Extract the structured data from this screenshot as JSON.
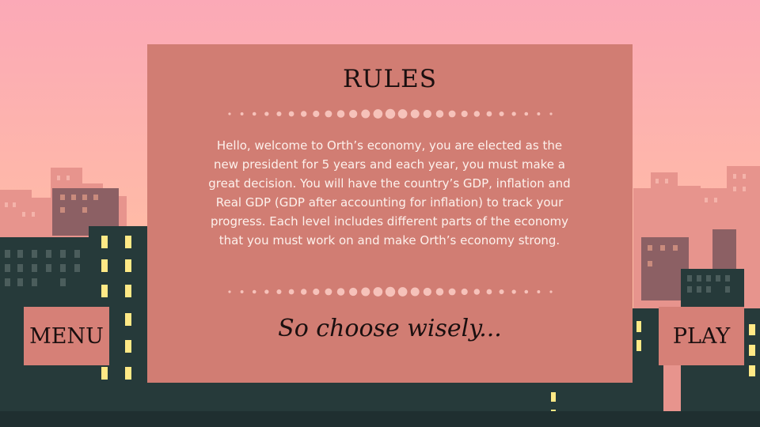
{
  "rules": {
    "title": "RULES",
    "body": "Hello, welcome to Orth’s economy, you are elected as the new president for 5 years and each year, you must make a great decision. You will have the country’s GDP, inflation and Real GDP (GDP after accounting for inflation) to track your progress. Each level includes different parts of the economy that you must work on and make Orth’s economy strong.",
    "tagline": "So choose wisely..."
  },
  "buttons": {
    "menu": "MENU",
    "play": "PLAY"
  },
  "colors": {
    "sky_top": "#fbaab7",
    "sky_bottom": "#ffc1a0",
    "panel": "#d17d73",
    "button": "#d68077",
    "building_dark": "#263a3a",
    "window_lit": "#ffe986",
    "city_far": "#e8928a"
  }
}
